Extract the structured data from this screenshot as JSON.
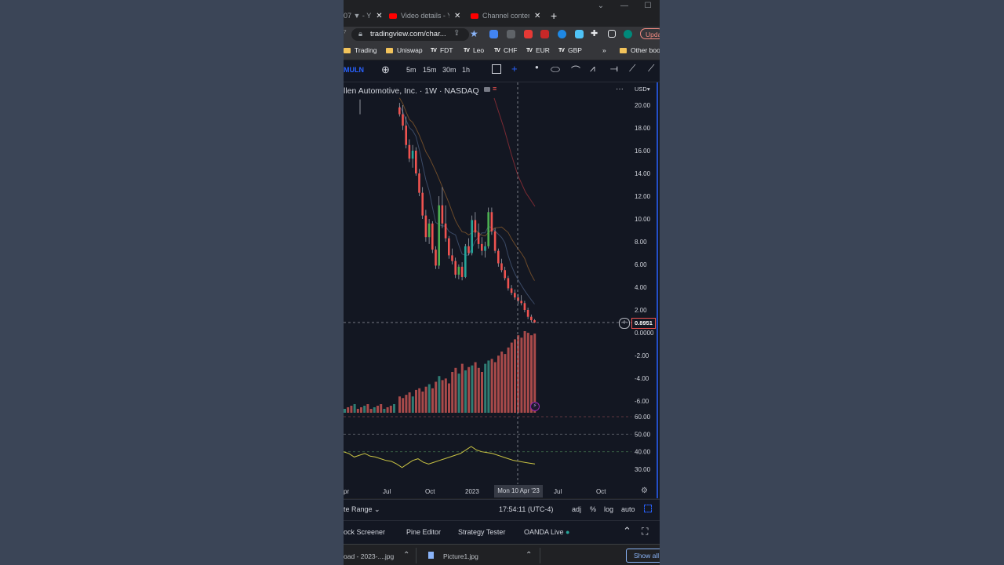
{
  "browser": {
    "tabs": [
      {
        "label": "07 ▼ - Y",
        "close": "✕"
      },
      {
        "label": "Video details - Yo",
        "close": "✕"
      },
      {
        "label": "Channel content",
        "close": "✕"
      }
    ],
    "new_tab": "+",
    "url": "tradingview.com/char...",
    "update_label": "Upda",
    "bookmarks": [
      {
        "label": "Trading",
        "icon": "folder"
      },
      {
        "label": "Uniswap",
        "icon": "folder"
      },
      {
        "label": "FDT",
        "icon": "tv"
      },
      {
        "label": "Leo",
        "icon": "tv"
      },
      {
        "label": "CHF",
        "icon": "tv"
      },
      {
        "label": "EUR",
        "icon": "tv"
      },
      {
        "label": "GBP",
        "icon": "tv"
      }
    ],
    "more": "»",
    "other_bookmarks": "Other boo"
  },
  "toolbar": {
    "symbol": "MULN",
    "intervals": [
      "5m",
      "15m",
      "30m",
      "1h"
    ]
  },
  "chart_header": {
    "title": "llen Automotive, Inc. · 1W · NASDAQ",
    "currency": "USD",
    "price_marker": "0.8951",
    "crosshair_date": "Mon 10 Apr '23"
  },
  "bottom_bar": {
    "date_range": "te Range",
    "time": "17:54:11 (UTC-4)",
    "adj": "adj",
    "percent": "%",
    "log": "log",
    "auto": "auto"
  },
  "panels": {
    "items": [
      "ock Screener",
      "Pine Editor",
      "Strategy Tester",
      "OANDA Live"
    ]
  },
  "downloads": {
    "items": [
      "oad - 2023-....jpg",
      "Picture1.jpg"
    ],
    "show_all": "Show all"
  },
  "colors": {
    "up": "#26a69a",
    "down": "#ef5350",
    "rsi": "#c9c343",
    "background": "#131722"
  },
  "chart_data": {
    "type": "candlestick",
    "title": "llen Automotive, Inc. · 1W · NASDAQ",
    "price_axis": [
      "20.00",
      "18.00",
      "16.00",
      "14.00",
      "12.00",
      "10.00",
      "8.00",
      "6.00",
      "4.00",
      "2.00",
      "0.0000",
      "-2.00",
      "-4.00",
      "-6.00"
    ],
    "price_range": [
      -7,
      21
    ],
    "rsi_axis": [
      "60.00",
      "50.00",
      "40.00",
      "30.00"
    ],
    "rsi_range": [
      26,
      64
    ],
    "time_axis": [
      "pr",
      "Jul",
      "Oct",
      "2023",
      "Jul",
      "Oct"
    ],
    "candles": [
      {
        "o": 19.8,
        "h": 20.2,
        "l": 19.0,
        "c": 19.2
      },
      {
        "o": 19.2,
        "h": 20.0,
        "l": 17.8,
        "c": 18.2
      },
      {
        "o": 18.2,
        "h": 19.0,
        "l": 16.2,
        "c": 16.5
      },
      {
        "o": 16.5,
        "h": 17.0,
        "l": 15.0,
        "c": 15.3
      },
      {
        "o": 15.3,
        "h": 16.5,
        "l": 14.5,
        "c": 16.0
      },
      {
        "o": 16.0,
        "h": 16.3,
        "l": 13.8,
        "c": 14.0
      },
      {
        "o": 14.0,
        "h": 14.4,
        "l": 12.0,
        "c": 12.3
      },
      {
        "o": 12.3,
        "h": 12.8,
        "l": 10.0,
        "c": 10.3
      },
      {
        "o": 10.3,
        "h": 10.8,
        "l": 8.0,
        "c": 8.4
      },
      {
        "o": 8.4,
        "h": 10.0,
        "l": 7.8,
        "c": 9.6
      },
      {
        "o": 9.6,
        "h": 9.8,
        "l": 7.0,
        "c": 7.3
      },
      {
        "o": 7.3,
        "h": 7.6,
        "l": 5.6,
        "c": 5.9
      },
      {
        "o": 5.9,
        "h": 12.0,
        "l": 5.6,
        "c": 11.2
      },
      {
        "o": 11.2,
        "h": 12.8,
        "l": 9.2,
        "c": 9.6
      },
      {
        "o": 9.6,
        "h": 11.2,
        "l": 8.0,
        "c": 8.3
      },
      {
        "o": 8.3,
        "h": 8.5,
        "l": 6.5,
        "c": 6.8
      },
      {
        "o": 6.8,
        "h": 7.4,
        "l": 6.0,
        "c": 6.3
      },
      {
        "o": 6.3,
        "h": 6.6,
        "l": 4.8,
        "c": 5.1
      },
      {
        "o": 5.1,
        "h": 6.0,
        "l": 4.7,
        "c": 5.8
      },
      {
        "o": 5.8,
        "h": 6.2,
        "l": 4.6,
        "c": 4.9
      },
      {
        "o": 4.9,
        "h": 7.8,
        "l": 4.8,
        "c": 7.6
      },
      {
        "o": 7.6,
        "h": 8.3,
        "l": 6.8,
        "c": 7.0
      },
      {
        "o": 7.0,
        "h": 10.3,
        "l": 6.8,
        "c": 9.9
      },
      {
        "o": 9.9,
        "h": 10.6,
        "l": 8.4,
        "c": 8.8
      },
      {
        "o": 8.8,
        "h": 9.6,
        "l": 7.4,
        "c": 7.8
      },
      {
        "o": 7.8,
        "h": 8.4,
        "l": 6.8,
        "c": 7.2
      },
      {
        "o": 7.2,
        "h": 8.0,
        "l": 6.6,
        "c": 7.6
      },
      {
        "o": 7.6,
        "h": 11.0,
        "l": 7.4,
        "c": 10.6
      },
      {
        "o": 10.6,
        "h": 11.0,
        "l": 8.6,
        "c": 8.9
      },
      {
        "o": 8.9,
        "h": 9.2,
        "l": 7.0,
        "c": 7.2
      },
      {
        "o": 7.2,
        "h": 7.4,
        "l": 5.8,
        "c": 6.1
      },
      {
        "o": 6.1,
        "h": 6.5,
        "l": 5.3,
        "c": 5.5
      },
      {
        "o": 5.5,
        "h": 5.8,
        "l": 4.6,
        "c": 4.8
      },
      {
        "o": 4.8,
        "h": 5.0,
        "l": 3.7,
        "c": 3.9
      },
      {
        "o": 3.9,
        "h": 4.2,
        "l": 3.3,
        "c": 3.5
      },
      {
        "o": 3.5,
        "h": 3.8,
        "l": 2.9,
        "c": 3.1
      },
      {
        "o": 3.1,
        "h": 3.4,
        "l": 2.5,
        "c": 2.8
      },
      {
        "o": 2.8,
        "h": 3.3,
        "l": 2.4,
        "c": 2.6
      },
      {
        "o": 2.6,
        "h": 2.8,
        "l": 1.8,
        "c": 2.0
      },
      {
        "o": 2.0,
        "h": 2.2,
        "l": 1.2,
        "c": 1.4
      },
      {
        "o": 1.4,
        "h": 1.6,
        "l": 0.9,
        "c": 1.1
      },
      {
        "o": 1.1,
        "h": 1.2,
        "l": 0.85,
        "c": 0.9
      }
    ],
    "volume": [
      0.2,
      0.18,
      0.22,
      0.25,
      0.2,
      0.28,
      0.3,
      0.26,
      0.32,
      0.35,
      0.3,
      0.38,
      0.45,
      0.4,
      0.42,
      0.36,
      0.5,
      0.55,
      0.48,
      0.6,
      0.52,
      0.56,
      0.58,
      0.62,
      0.55,
      0.5,
      0.6,
      0.64,
      0.66,
      0.62,
      0.7,
      0.75,
      0.72,
      0.8,
      0.86,
      0.9,
      0.95,
      0.92,
      1.0,
      0.98,
      0.95,
      0.97
    ],
    "rsi": [
      40,
      39,
      37,
      38,
      39,
      37.5,
      37,
      36,
      35,
      34.5,
      33,
      31,
      33,
      35,
      36,
      34,
      33,
      34,
      35,
      36,
      37,
      38,
      39,
      41,
      43,
      41,
      40,
      39.5,
      39,
      38,
      37,
      36,
      35,
      34.5,
      34,
      33.5,
      33
    ]
  }
}
